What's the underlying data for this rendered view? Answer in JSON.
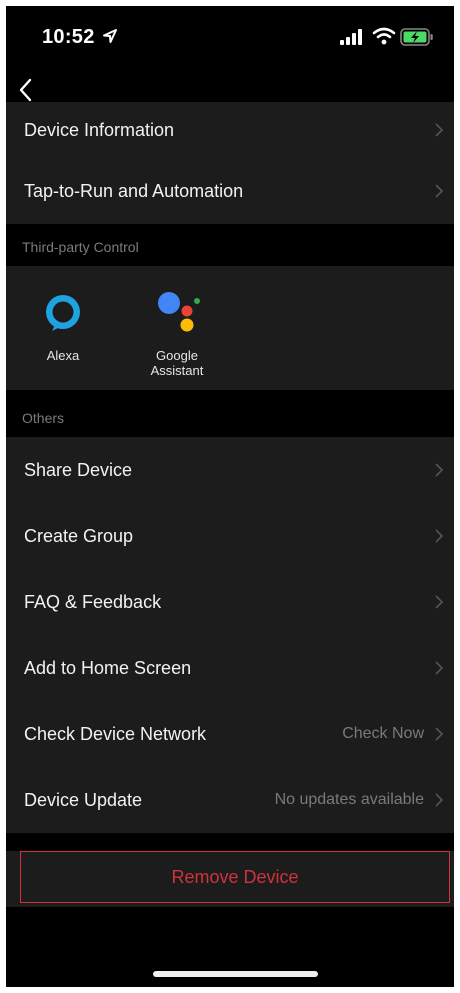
{
  "status_bar": {
    "time": "10:52",
    "icons": [
      "location-arrow-icon",
      "cellular-signal-icon",
      "wifi-icon",
      "battery-charging-icon"
    ]
  },
  "nav": {
    "back_icon": "chevron-left-icon"
  },
  "group_top": {
    "items": [
      {
        "label": "Device Information"
      },
      {
        "label": "Tap-to-Run and Automation"
      }
    ]
  },
  "third_party": {
    "title": "Third-party Control",
    "items": [
      {
        "label": "Alexa",
        "icon": "alexa-icon"
      },
      {
        "label": "Google\nAssistant",
        "icon": "google-assistant-icon"
      }
    ]
  },
  "others": {
    "title": "Others",
    "items": [
      {
        "label": "Share Device",
        "value": ""
      },
      {
        "label": "Create Group",
        "value": ""
      },
      {
        "label": "FAQ & Feedback",
        "value": ""
      },
      {
        "label": "Add to Home Screen",
        "value": ""
      },
      {
        "label": "Check Device Network",
        "value": "Check Now"
      },
      {
        "label": "Device Update",
        "value": "No updates available"
      }
    ]
  },
  "remove_button": {
    "label": "Remove Device"
  },
  "colors": {
    "background": "#000000",
    "cell": "#1c1c1c",
    "danger": "#d0333a",
    "secondary_text": "#7a7a7a",
    "alexa": "#1fa3e0",
    "google_blue": "#4285f4",
    "google_red": "#ea4335",
    "google_yellow": "#fbbc05",
    "google_green": "#34a853"
  }
}
